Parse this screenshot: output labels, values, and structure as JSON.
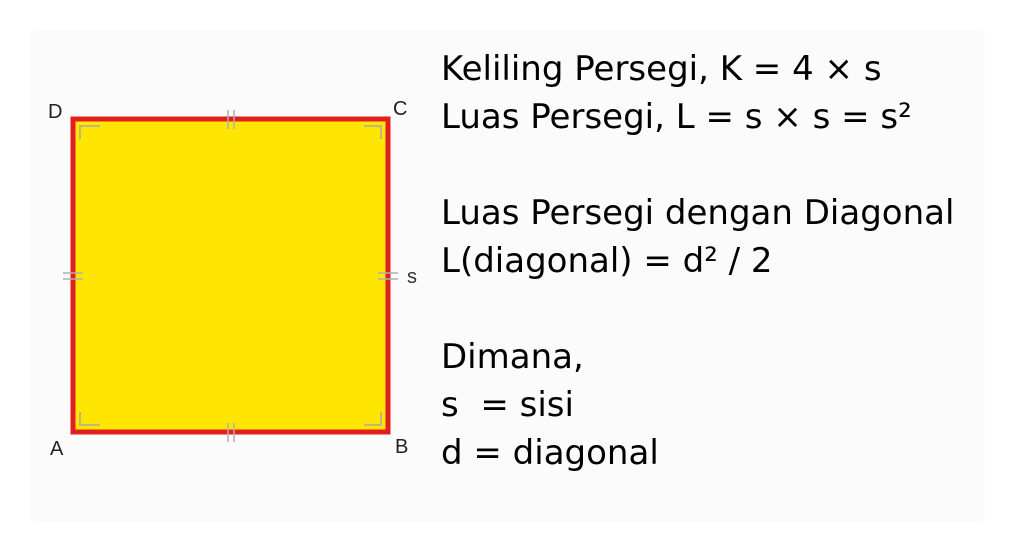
{
  "diagram": {
    "vertices": {
      "A": "A",
      "B": "B",
      "C": "C",
      "D": "D"
    },
    "side_label": "s",
    "colors": {
      "fill": "#FFE600",
      "stroke": "#E02020",
      "tick": "#B0B0B0",
      "corner": "#A8A8A8"
    }
  },
  "formulas": {
    "perimeter": "Keliling Persegi, K = 4 × s",
    "area": "Luas Persegi, L = s × s = s²",
    "diagonal_heading": "Luas Persegi dengan Diagonal",
    "diagonal_formula": "L(diagonal) = d² / 2",
    "where": "Dimana,",
    "def_s": "s  = sisi",
    "def_d": "d = diagonal"
  }
}
